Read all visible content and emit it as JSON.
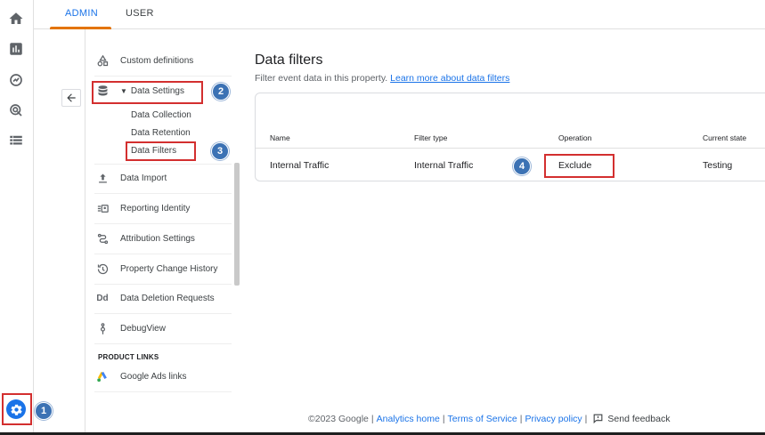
{
  "tabs": [
    {
      "label": "ADMIN",
      "active": true
    },
    {
      "label": "USER",
      "active": false
    }
  ],
  "rail": {
    "icons": [
      "home-icon",
      "reports-icon",
      "explore-icon",
      "advertising-icon",
      "configure-icon"
    ],
    "settings_icon": "gear-icon"
  },
  "menu": {
    "items": [
      {
        "label": "Custom definitions",
        "icon": "shapes-icon"
      },
      {
        "label": "Data Settings",
        "icon": "database-icon"
      },
      {
        "label": "Data Import",
        "icon": "upload-icon"
      },
      {
        "label": "Reporting Identity",
        "icon": "identity-icon"
      },
      {
        "label": "Attribution Settings",
        "icon": "attribution-icon"
      },
      {
        "label": "Property Change History",
        "icon": "history-icon"
      },
      {
        "label": "Data Deletion Requests",
        "icon": "Dd"
      },
      {
        "label": "DebugView",
        "icon": "debug-icon"
      }
    ],
    "sub_items": [
      "Data Collection",
      "Data Retention",
      "Data Filters"
    ],
    "section_title": "PRODUCT LINKS",
    "product_links": [
      {
        "label": "Google Ads links",
        "icon": "google-ads-icon"
      }
    ]
  },
  "badges": [
    "1",
    "2",
    "3",
    "4"
  ],
  "main": {
    "title": "Data filters",
    "subtitle": "Filter event data in this property.",
    "learn_more": "Learn more about data filters",
    "table": {
      "columns": [
        "Name",
        "Filter type",
        "Operation",
        "Current state"
      ],
      "rows": [
        [
          "Internal Traffic",
          "Internal Traffic",
          "Exclude",
          "Testing"
        ]
      ]
    }
  },
  "footer": {
    "copyright": "©2023 Google",
    "links": [
      "Analytics home",
      "Terms of Service",
      "Privacy policy"
    ],
    "separator": "|",
    "feedback": "Send feedback"
  },
  "colors": {
    "accent": "#1a73e8",
    "tab_underline": "#e37400",
    "highlight": "#d32f2f",
    "badge": "#3c72b4"
  }
}
